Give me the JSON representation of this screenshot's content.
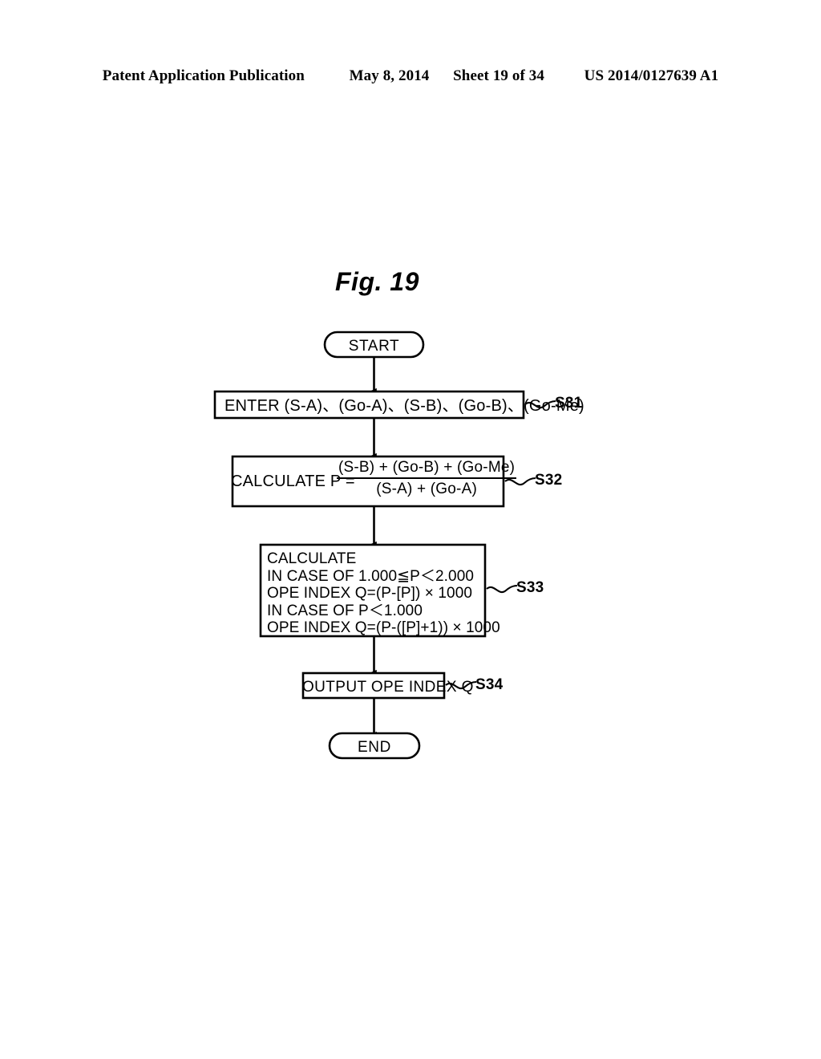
{
  "header": {
    "publication": "Patent Application Publication",
    "date": "May 8, 2014",
    "sheet": "Sheet 19 of 34",
    "patent_number": "US 2014/0127639 A1"
  },
  "figure": {
    "title": "Fig. 19"
  },
  "flowchart": {
    "start": {
      "label": "START"
    },
    "step_s31": {
      "text": "ENTER (S-A)、(Go-A)、(S-B)、(Go-B)、(Go-Me)",
      "tag": "S31"
    },
    "step_s32": {
      "prefix": "CALCULATE  P =",
      "numerator": "(S-B) + (Go-B) + (Go-Me)",
      "denominator": "(S-A) + (Go-A)",
      "tag": "S32"
    },
    "step_s33": {
      "lines": [
        "CALCULATE",
        "IN CASE OF 1.000≦P＜2.000",
        "OPE INDEX Q=(P-[P]) × 1000",
        "IN CASE OF P＜1.000",
        "OPE INDEX Q=(P-([P]+1)) × 1000"
      ],
      "tag": "S33"
    },
    "step_s34": {
      "text": "OUTPUT OPE INDEX Q",
      "tag": "S34"
    },
    "end": {
      "label": "END"
    }
  },
  "colors": {
    "ink": "#000000",
    "paper": "#ffffff"
  }
}
